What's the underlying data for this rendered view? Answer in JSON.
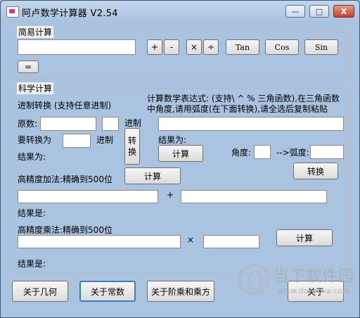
{
  "window": {
    "title": "阿卢数学计算器 V2.54",
    "min": "—",
    "max": "□",
    "close": "X"
  },
  "simple": {
    "group_label": "简易计算",
    "ops": [
      "+",
      "-",
      "×",
      "÷"
    ],
    "funcs": [
      "Tan",
      "Cos",
      "Sin"
    ],
    "equals": "="
  },
  "science": {
    "group_label": "科学计算",
    "base_title": "进制转换 (支持任意进制)",
    "original_label": "原数:",
    "base_suffix_1": "进制",
    "convert_to_label": "要转换为",
    "base_suffix_2": "进制",
    "result_label_1": "结果为:",
    "convert_vertical": [
      "转",
      "换"
    ],
    "expr_title": "计算数学表达式: (支持\\ ^ % 三角函数),在三角函数中角度,请用弧度(在下面转换),请全选后复制粘贴",
    "expr_result_label": "结果为:",
    "expr_calc_button": "计算",
    "angle_label": "角度:",
    "radian_label": "-->弧度:",
    "angle_convert_button": "转换",
    "hp_add_title": "高精度加法:精确到500位",
    "hp_add_calc_button": "计算",
    "plus_sign": "+",
    "hp_add_result_label": "结果是:",
    "hp_mul_title": "高精度乘法:精确到500位",
    "times_sign": "×",
    "hp_mul_calc_button": "计算",
    "hp_mul_result_label": "结果是:"
  },
  "bottom": {
    "about_geometry": "关于几何",
    "about_constants": "关于常数",
    "about_factorial": "关于阶乘和乘方",
    "about": "关于"
  },
  "watermark": {
    "text": "当下软件园",
    "url": "www.downxia.com"
  }
}
